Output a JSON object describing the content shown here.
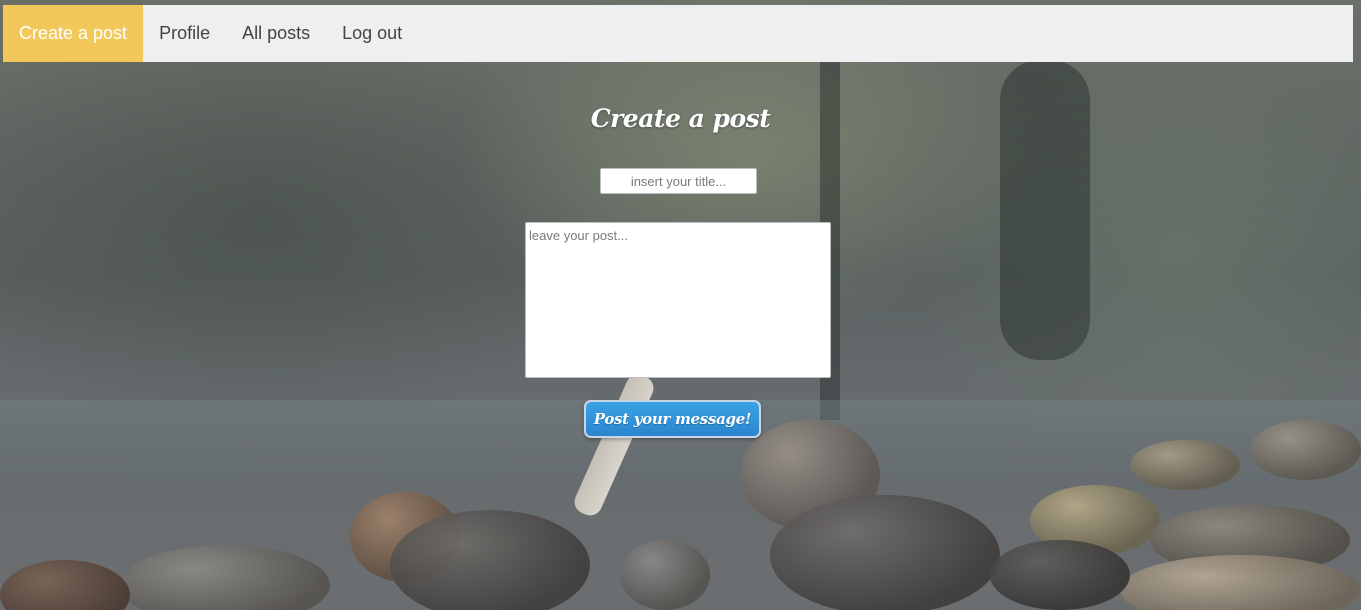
{
  "nav": {
    "items": [
      {
        "label": "Create a post",
        "active": true
      },
      {
        "label": "Profile",
        "active": false
      },
      {
        "label": "All posts",
        "active": false
      },
      {
        "label": "Log out",
        "active": false
      }
    ]
  },
  "form": {
    "heading": "Create a post",
    "title_placeholder": "insert your title...",
    "title_value": "",
    "post_placeholder": "leave your post...",
    "post_value": "",
    "submit_label": "Post your message!"
  },
  "colors": {
    "nav_background": "#efefef",
    "nav_active": "#f2c85b",
    "submit_button": "#2b86cf"
  }
}
